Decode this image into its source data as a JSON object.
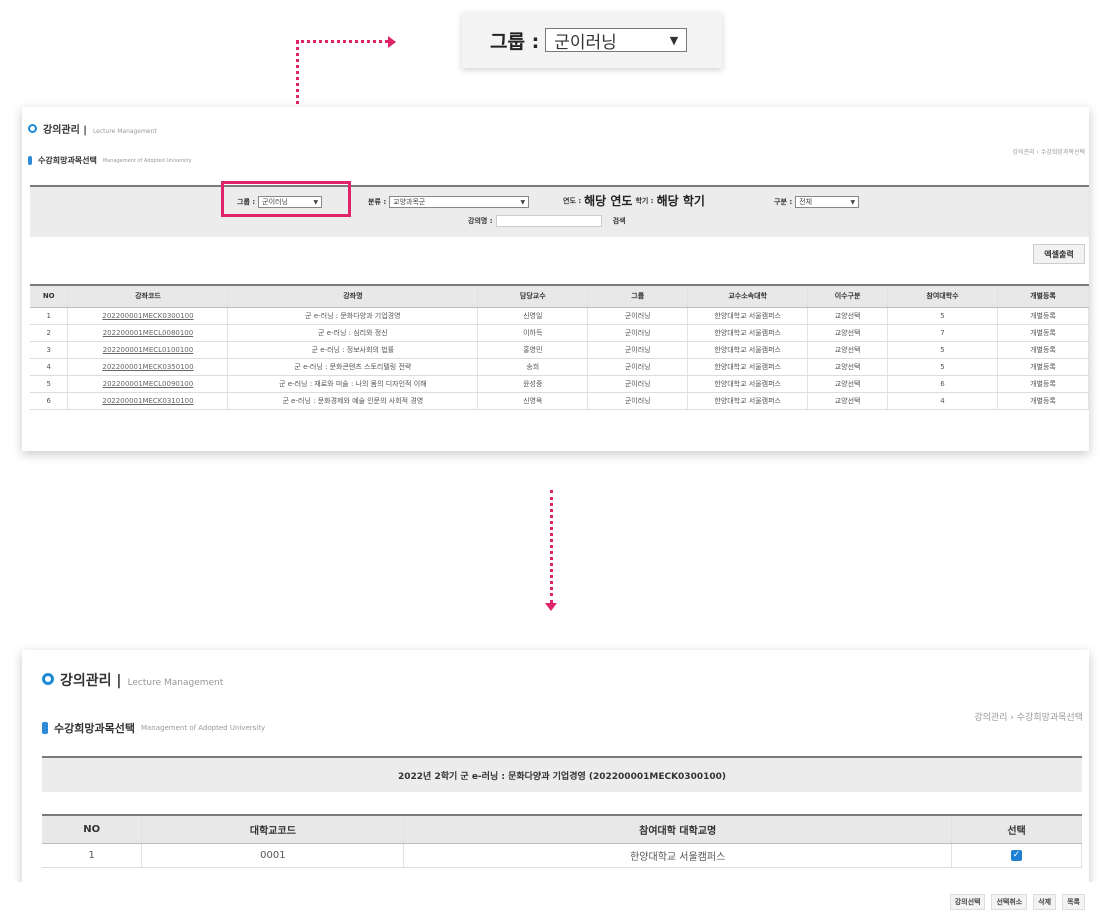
{
  "callout": {
    "label": "그룹 :",
    "value": "군이러닝"
  },
  "panel1": {
    "title_ko": "강의관리 |",
    "title_en": "Lecture Management",
    "sub_ko": "수강희망과목선택",
    "sub_en": "Management of Adopted University",
    "breadcrumb": "강의관리 › 수강희망과목선택",
    "search": {
      "group_label": "그룹 :",
      "group_value": "군이러닝",
      "category_label": "분류 :",
      "category_value": "교양과목군",
      "year_label": "연도 :",
      "year_value": "해당 연도",
      "term_label": "학기 :",
      "term_value": "해당 학기",
      "type_label": "구분 :",
      "type_value": "전체",
      "lecture_label": "강의명 :",
      "search_btn": "검색"
    },
    "excel_btn": "엑셀출력",
    "columns": [
      "NO",
      "강좌코드",
      "강좌명",
      "담당교수",
      "그룹",
      "교수소속대학",
      "이수구분",
      "참여대학수",
      "개별등록"
    ],
    "rows": [
      [
        "1",
        "202200001MECK0300100",
        "군 e-러닝 : 문화다양과 기업경영",
        "신영일",
        "군이러닝",
        "한양대학교 서울캠퍼스",
        "교양선택",
        "5",
        "개별등록"
      ],
      [
        "2",
        "202200001MECL0080100",
        "군 e-러닝 : 심리와 정신",
        "이하득",
        "군이러닝",
        "한양대학교 서울캠퍼스",
        "교양선택",
        "7",
        "개별등록"
      ],
      [
        "3",
        "202200001MECL0100100",
        "군 e-러닝 : 정보사회의 법률",
        "홍영민",
        "군이러닝",
        "한양대학교 서울캠퍼스",
        "교양선택",
        "5",
        "개별등록"
      ],
      [
        "4",
        "202200001MECK0350100",
        "군 e-러닝 : 문화콘텐츠 스토리텔링 전략",
        "송희",
        "군이러닝",
        "한양대학교 서울캠퍼스",
        "교양선택",
        "5",
        "개별등록"
      ],
      [
        "5",
        "202200001MECL0090100",
        "군 e-러닝 : 재료와 미술 : 나의 몸의 디자인적 이해",
        "윤성중",
        "군이러닝",
        "한양대학교 서울캠퍼스",
        "교양선택",
        "6",
        "개별등록"
      ],
      [
        "6",
        "202200001MECK0310100",
        "군 e-러닝 : 문화경제와 예술 인문의 사회적 경영",
        "신영옥",
        "군이러닝",
        "한양대학교 서울캠퍼스",
        "교양선택",
        "4",
        "개별등록"
      ]
    ]
  },
  "panel2": {
    "title_ko": "강의관리 |",
    "title_en": "Lecture Management",
    "sub_ko": "수강희망과목선택",
    "sub_en": "Management of Adopted University",
    "breadcrumb": "강의관리 › 수강희망과목선택",
    "info": "2022년 2학기 군 e-러닝 : 문화다양과 기업경영 (202200001MECK0300100)",
    "columns": [
      "NO",
      "대학교코드",
      "참여대학 대학교명",
      "선택"
    ],
    "rows": [
      {
        "no": "1",
        "code": "0001",
        "name": "한양대학교 서울캠퍼스",
        "checked": true
      }
    ],
    "buttons": [
      "강의선택",
      "선택취소",
      "삭제",
      "목록"
    ]
  },
  "colors": {
    "accent": "#e0246a",
    "brand": "#1f8ad6"
  }
}
